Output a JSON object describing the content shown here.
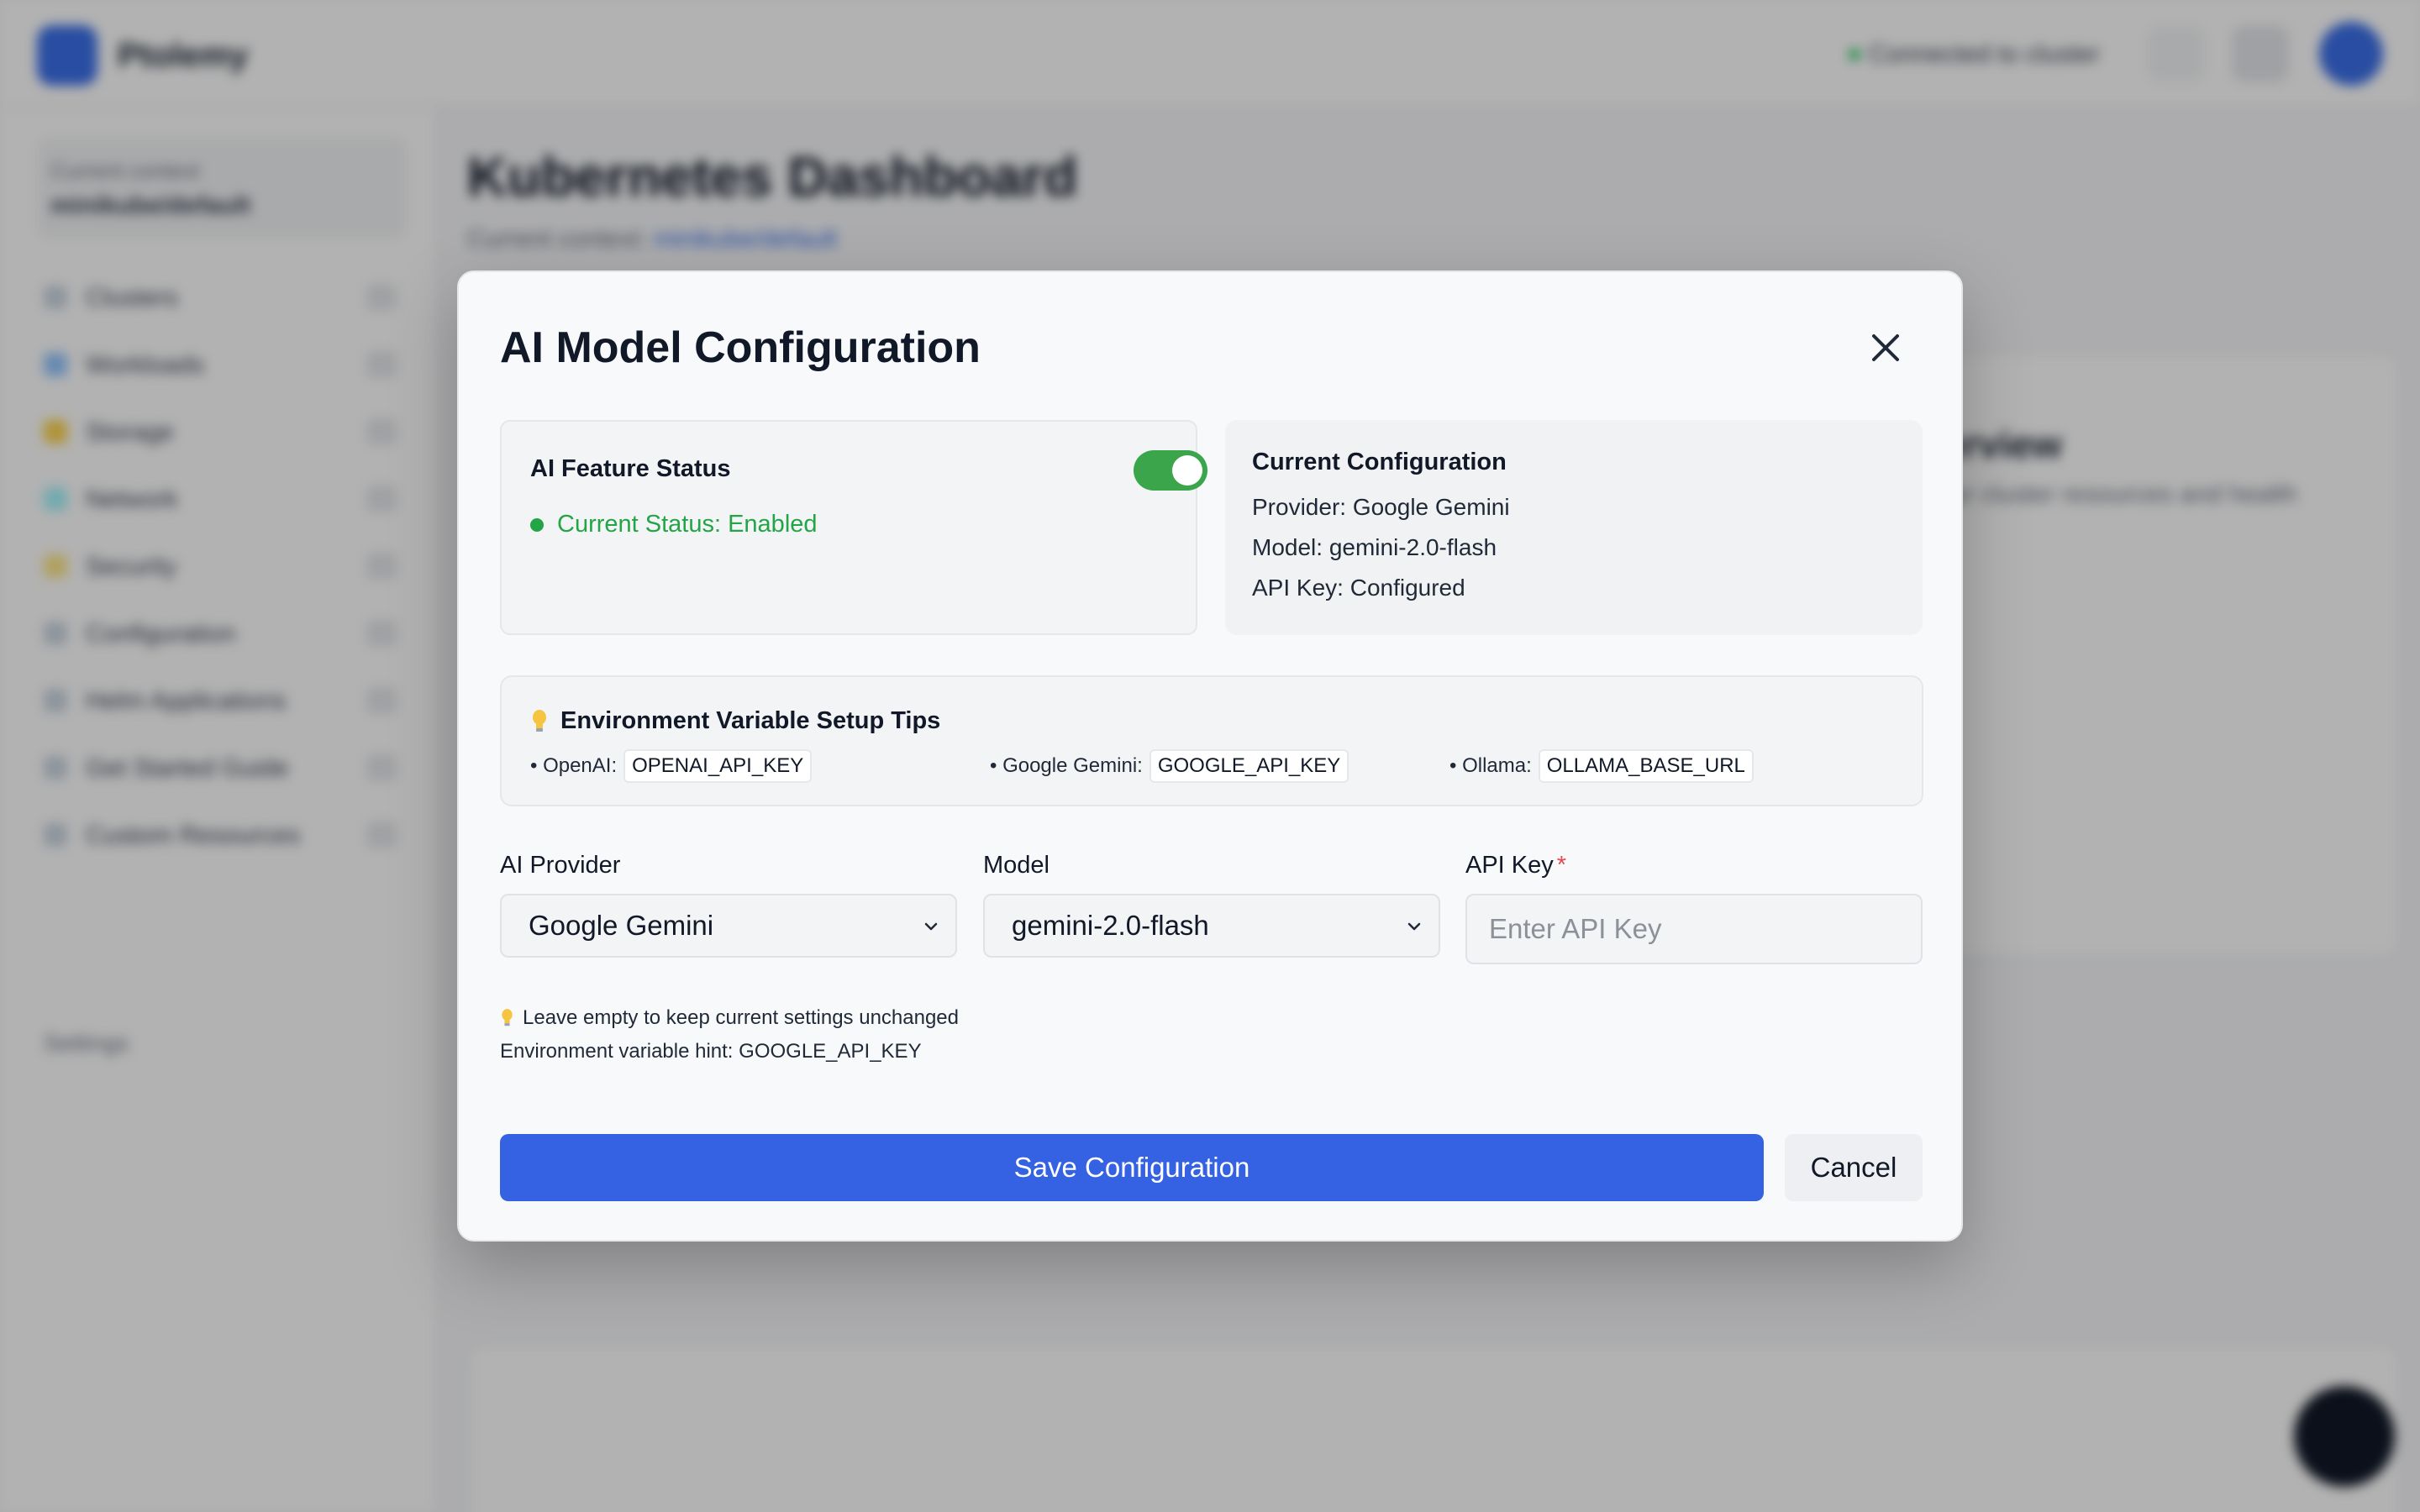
{
  "background": {
    "brand": "Ptolemy",
    "connection_status": "Connected to cluster",
    "context_label": "Current context",
    "context_value": "minikube/default",
    "nav_items": [
      {
        "label": "Clusters"
      },
      {
        "label": "Workloads"
      },
      {
        "label": "Storage"
      },
      {
        "label": "Network"
      },
      {
        "label": "Security"
      },
      {
        "label": "Configuration"
      },
      {
        "label": "Helm Applications"
      },
      {
        "label": "Get Started Guide"
      },
      {
        "label": "Custom Resources"
      }
    ],
    "nav_footer": "Settings",
    "page_title": "Kubernetes Dashboard",
    "page_subtitle_prefix": "Current context: ",
    "page_subtitle_link": "minikube/default",
    "panel_heading": "Cluster Overview",
    "panel_text": "Monitor and manage your cluster resources and health"
  },
  "modal": {
    "title": "AI Model Configuration",
    "feature_status": {
      "title": "AI Feature Status",
      "enabled": true,
      "status_text": "Current Status: Enabled"
    },
    "current_config": {
      "title": "Current Configuration",
      "provider": "Provider: Google Gemini",
      "model": "Model: gemini-2.0-flash",
      "api_key": "API Key: Configured"
    },
    "tips": {
      "title": "Environment Variable Setup Tips",
      "items": [
        {
          "label": "• OpenAI:",
          "code": "OPENAI_API_KEY"
        },
        {
          "label": "• Google Gemini:",
          "code": "GOOGLE_API_KEY"
        },
        {
          "label": "• Ollama:",
          "code": "OLLAMA_BASE_URL"
        }
      ]
    },
    "form": {
      "provider_label": "AI Provider",
      "provider_value": "Google Gemini",
      "model_label": "Model",
      "model_value": "gemini-2.0-flash",
      "api_key_label": "API Key",
      "api_key_required": "*",
      "api_key_placeholder": "Enter API Key"
    },
    "hints": {
      "keep_empty": "Leave empty to keep current settings unchanged",
      "env_hint": "Environment variable hint: GOOGLE_API_KEY"
    },
    "buttons": {
      "save": "Save Configuration",
      "cancel": "Cancel"
    }
  },
  "colors": {
    "primary": "#3462e3",
    "toggle_on": "#3aa54a",
    "status_green": "#22a447",
    "required": "#e5484d"
  }
}
